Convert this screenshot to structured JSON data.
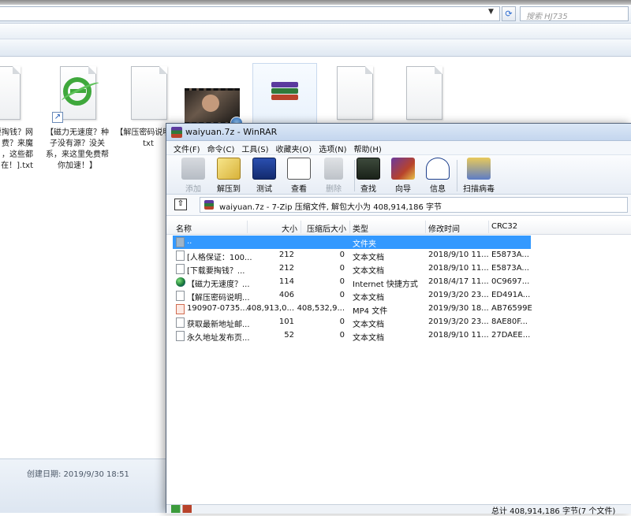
{
  "explorer": {
    "search_placeholder": "搜索 HJ735",
    "files": [
      {
        "label": "要掏钱？网\n费？来魔\n，这些都\n在！].txt",
        "icon": "text-file-icon"
      },
      {
        "label": "【磁力无速度？种子没有源？没关系，来这里免费帮你加速！】",
        "icon": "internet-shortcut-icon"
      },
      {
        "label": "【解压密码说明】.txt",
        "icon": "text-file-icon"
      },
      {
        "label": "",
        "icon": "video-file-icon"
      },
      {
        "label": "",
        "icon": "winrar-archive-icon"
      },
      {
        "label": "",
        "icon": "text-file-icon"
      },
      {
        "label": "",
        "icon": "text-file-icon"
      }
    ],
    "status_created": "创建日期: 2019/9/30 18:51"
  },
  "winrar": {
    "title": "waiyuan.7z - WinRAR",
    "menu": [
      "文件(F)",
      "命令(C)",
      "工具(S)",
      "收藏夹(O)",
      "选项(N)",
      "帮助(H)"
    ],
    "toolbar": [
      {
        "label": "添加",
        "icon": "add-icon",
        "disabled": true
      },
      {
        "label": "解压到",
        "icon": "extract-to-icon",
        "disabled": false
      },
      {
        "label": "测试",
        "icon": "test-icon",
        "disabled": false
      },
      {
        "label": "查看",
        "icon": "view-icon",
        "disabled": false
      },
      {
        "label": "删除",
        "icon": "delete-icon",
        "disabled": true
      },
      {
        "label": "查找",
        "icon": "find-icon",
        "disabled": false
      },
      {
        "label": "向导",
        "icon": "wizard-icon",
        "disabled": false
      },
      {
        "label": "信息",
        "icon": "info-icon",
        "disabled": false
      },
      {
        "label": "扫描病毒",
        "icon": "virus-scan-icon",
        "disabled": false
      }
    ],
    "path_text": "waiyuan.7z - 7-Zip 压缩文件, 解包大小为 408,914,186 字节",
    "columns": [
      "名称",
      "大小",
      "压缩后大小",
      "类型",
      "修改时间",
      "CRC32"
    ],
    "rows": [
      {
        "name": "..",
        "size": "",
        "packed": "",
        "type": "文件夹",
        "modified": "",
        "crc": "",
        "icon": "folder",
        "selected": true
      },
      {
        "name": "[人格保证：100...",
        "size": "212",
        "packed": "0",
        "type": "文本文档",
        "modified": "2018/9/10 11...",
        "crc": "E5873A...",
        "icon": "txt",
        "selected": false
      },
      {
        "name": "[下载要掏钱？...",
        "size": "212",
        "packed": "0",
        "type": "文本文档",
        "modified": "2018/9/10 11...",
        "crc": "E5873A...",
        "icon": "txt",
        "selected": false
      },
      {
        "name": "【磁力无速度？...",
        "size": "114",
        "packed": "0",
        "type": "Internet 快捷方式",
        "modified": "2018/4/17 11...",
        "crc": "0C9697...",
        "icon": "globe",
        "selected": false
      },
      {
        "name": "【解压密码说明...",
        "size": "406",
        "packed": "0",
        "type": "文本文档",
        "modified": "2019/3/20 23...",
        "crc": "ED491A...",
        "icon": "txt",
        "selected": false
      },
      {
        "name": "190907-0735....",
        "size": "408,913,0...",
        "packed": "408,532,9...",
        "type": "MP4 文件",
        "modified": "2019/9/30 18...",
        "crc": "AB76599E",
        "icon": "mp4",
        "selected": false
      },
      {
        "name": "获取最新地址邮...",
        "size": "101",
        "packed": "0",
        "type": "文本文档",
        "modified": "2019/3/20 23...",
        "crc": "8AE80F...",
        "icon": "txt",
        "selected": false
      },
      {
        "name": "永久地址发布页...",
        "size": "52",
        "packed": "0",
        "type": "文本文档",
        "modified": "2018/9/10 11...",
        "crc": "27DAEE...",
        "icon": "txt",
        "selected": false
      }
    ],
    "status_text": "总计 408,914,186 字节(7 个文件)"
  }
}
